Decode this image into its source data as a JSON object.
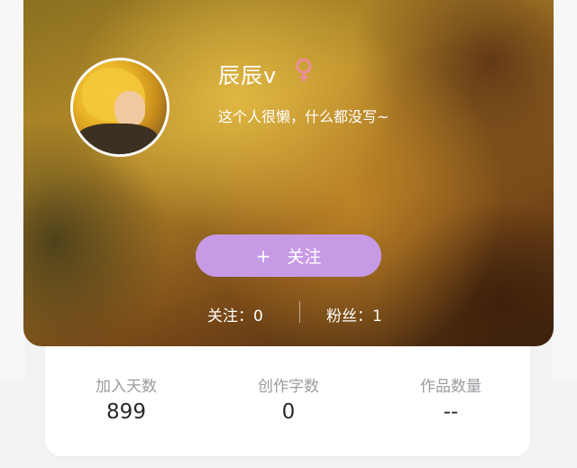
{
  "profile": {
    "username": "辰辰v",
    "gender_icon": "♀",
    "signature": "这个人很懒，什么都没写~"
  },
  "follow_button": {
    "icon": "+",
    "label": "关注"
  },
  "follow_stats": {
    "following": "关注：0",
    "fans": "粉丝：1"
  },
  "stats": [
    {
      "label": "加入天数",
      "value": "899"
    },
    {
      "label": "创作字数",
      "value": "0"
    },
    {
      "label": "作品数量",
      "value": "--"
    }
  ],
  "colors": {
    "accent_bar": "#31b4ef",
    "follow_button": "#c79ae6",
    "gender": "#f08aa7"
  }
}
